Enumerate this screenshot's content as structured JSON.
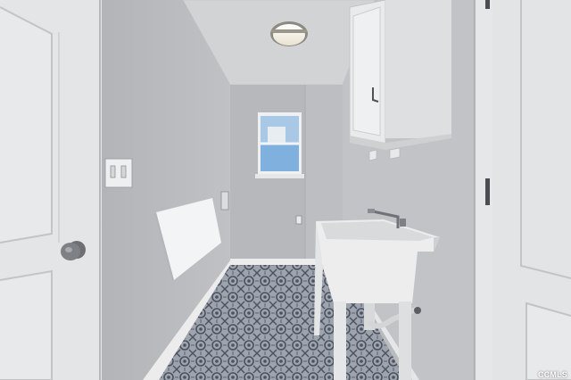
{
  "photo": {
    "subject": "laundry-room-with-utility-sink",
    "colors": {
      "wall": "#b9bbbe",
      "ceiling": "#d4d5d7",
      "door": "#e3e4e5",
      "trim": "#e9e9ea",
      "tile_base": "#9aa1ab",
      "tile_pattern": "#49515d",
      "window_sky": "#6aa3d8"
    }
  },
  "watermark": {
    "text": "CCMLS"
  }
}
